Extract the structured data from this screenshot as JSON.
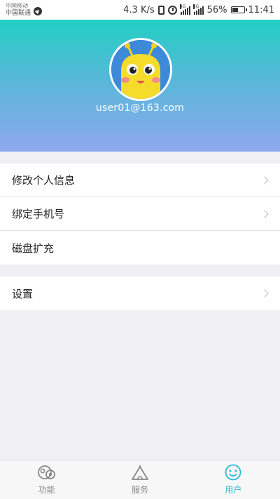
{
  "status_bar": {
    "carrier_top": "中国移动",
    "carrier_bottom": "中国联通",
    "net_speed": "4.3 K/s",
    "network_4g": "4G",
    "network_3g": "3G",
    "battery": "56%",
    "battery_level": 0.56,
    "time": "11:41"
  },
  "profile": {
    "email": "user01@163.com",
    "avatar_icon": "yellow-bug-avatar",
    "gradient": [
      "#22cfc4",
      "#8fa8f0"
    ]
  },
  "menu": {
    "group1": [
      {
        "label": "修改个人信息",
        "has_arrow": true
      },
      {
        "label": "绑定手机号",
        "has_arrow": true
      },
      {
        "label": "磁盘扩充",
        "has_arrow": false
      }
    ],
    "group2": [
      {
        "label": "设置",
        "has_arrow": true
      }
    ]
  },
  "tabs": [
    {
      "label": "功能",
      "icon": "function-icon",
      "active": false
    },
    {
      "label": "服务",
      "icon": "service-icon",
      "active": false
    },
    {
      "label": "用户",
      "icon": "user-smile-icon",
      "active": true
    }
  ],
  "colors": {
    "accent": "#2ab8d8",
    "inactive": "#888888"
  }
}
